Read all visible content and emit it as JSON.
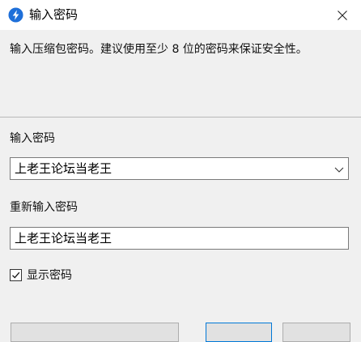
{
  "window": {
    "title": "输入密码",
    "close_glyph": "✕"
  },
  "description": "输入压缩包密码。建议使用至少 8 位的密码来保证安全性。",
  "password": {
    "label": "输入密码",
    "value": "上老王论坛当老王"
  },
  "confirm": {
    "label": "重新输入密码",
    "value": "上老王论坛当老王"
  },
  "show_password": {
    "label": "显示密码",
    "checked": true
  },
  "colors": {
    "accent": "#0078d7",
    "app_icon": "#1e6fd9"
  }
}
